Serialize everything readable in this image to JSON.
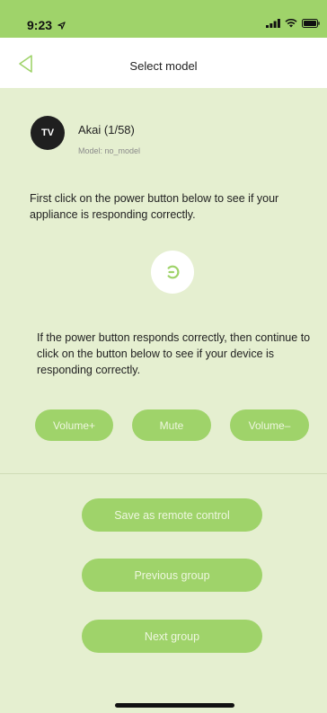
{
  "status_bar": {
    "time": "9:23"
  },
  "nav": {
    "title": "Select model"
  },
  "device": {
    "avatar_text": "TV",
    "name": "Akai (1/58)",
    "model": "Model: no_model"
  },
  "instructions": {
    "power_hint": "First click on the power button below to see if your appliance is responding correctly.",
    "buttons_hint": "If the power button responds correctly, then continue to click on the button below to see if your device is responding correctly."
  },
  "test_buttons": {
    "volume_up": "Volume+",
    "mute": "Mute",
    "volume_down": "Volume–"
  },
  "actions": {
    "save": "Save as remote control",
    "previous": "Previous group",
    "next": "Next group"
  },
  "colors": {
    "accent": "#9fd36a",
    "background": "#e5efd0",
    "header": "#ffffff"
  },
  "icons": {
    "back": "back-arrow-icon",
    "power": "power-icon",
    "signal": "signal-icon",
    "wifi": "wifi-icon",
    "battery": "battery-icon",
    "location": "location-arrow-icon"
  }
}
